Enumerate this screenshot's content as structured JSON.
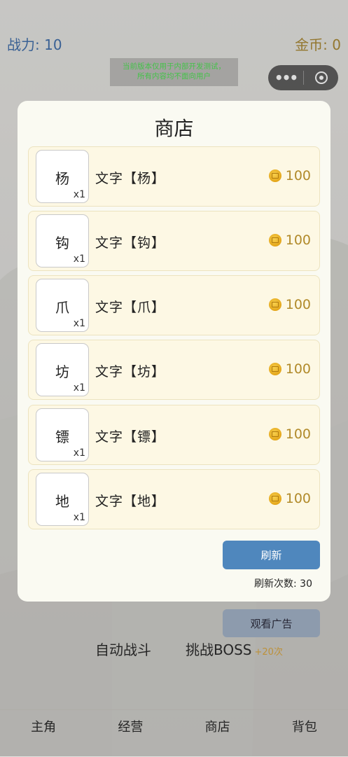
{
  "header": {
    "power": "战力: 10",
    "gold": "金币: 0"
  },
  "notice": {
    "line1": "当前版本仅用于内部开发测试，",
    "line2": "所有内容均不面向用户"
  },
  "capsule": {
    "more_icon": "more-dots-icon",
    "close_icon": "target-icon"
  },
  "shop": {
    "title": "商店",
    "items": [
      {
        "glyph": "杨",
        "qty": "x1",
        "name": "文字【杨】",
        "price": "100"
      },
      {
        "glyph": "钩",
        "qty": "x1",
        "name": "文字【钩】",
        "price": "100"
      },
      {
        "glyph": "爪",
        "qty": "x1",
        "name": "文字【爪】",
        "price": "100"
      },
      {
        "glyph": "坊",
        "qty": "x1",
        "name": "文字【坊】",
        "price": "100"
      },
      {
        "glyph": "镖",
        "qty": "x1",
        "name": "文字【镖】",
        "price": "100"
      },
      {
        "glyph": "地",
        "qty": "x1",
        "name": "文字【地】",
        "price": "100"
      }
    ],
    "refresh_label": "刷新",
    "refresh_count": "刷新次数: 30"
  },
  "main": {
    "watch_ad": "观看广告",
    "auto_battle": "自动战斗",
    "challenge_boss": "挑战BOSS",
    "boss_sub": "+20次"
  },
  "nav": {
    "hero": "主角",
    "manage": "经营",
    "shop": "商店",
    "bag": "背包"
  },
  "colors": {
    "accent_blue": "#4f87bd",
    "gold": "#b18a2a",
    "power_blue": "#3a6aa8"
  }
}
